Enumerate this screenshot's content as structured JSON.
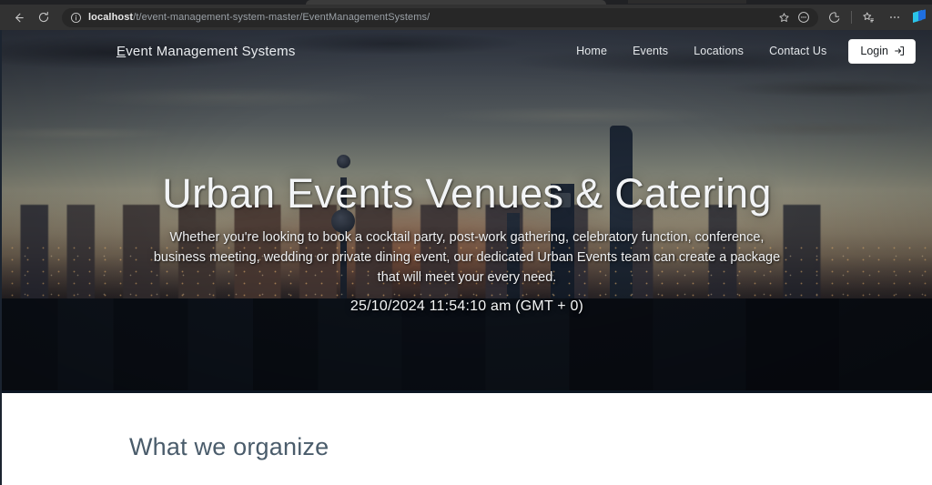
{
  "browser": {
    "back_icon": "back-arrow-icon",
    "reload_icon": "reload-icon",
    "site_info_icon": "info-circle-icon",
    "url_prefix": "localhost",
    "url_path": "/t/event-management-system-master/EventManagementSystems/",
    "url_full": "localhost/t/event-management-system-master/EventManagementSystems/",
    "favorite_icon": "star-outline-icon",
    "split_screen_icon": "split-screen-icon",
    "browser_essentials_icon": "browser-essentials-icon",
    "collections_icon": "collections-icon",
    "settings_more_icon": "ellipsis-icon",
    "extension_icon": "extension-icon"
  },
  "site": {
    "brand": {
      "accesskey_letter": "E",
      "rest": "vent Management Systems",
      "full": "Event Management Systems"
    },
    "nav": [
      {
        "label": "Home",
        "name": "nav-link-home"
      },
      {
        "label": "Events",
        "name": "nav-link-events"
      },
      {
        "label": "Locations",
        "name": "nav-link-locations"
      },
      {
        "label": "Contact Us",
        "name": "nav-link-contact-us"
      }
    ],
    "login_button": {
      "label": "Login",
      "icon": "sign-in-icon"
    },
    "hero": {
      "title": "Urban Events Venues & Catering",
      "subtitle": "Whether you're looking to book a cocktail party, post-work gathering, celebratory function, conference, business meeting, wedding or private dining event, our dedicated Urban Events team can create a package that will meet your every need.",
      "datetime": "25/10/2024 11:54:10 am (GMT + 0)"
    },
    "section": {
      "title": "What we organize"
    },
    "colors": {
      "section_title": "#4a5c6b",
      "login_button_bg": "#ffffff",
      "nav_text": "#e4e7ea",
      "divider": "#e2e5e8"
    }
  }
}
